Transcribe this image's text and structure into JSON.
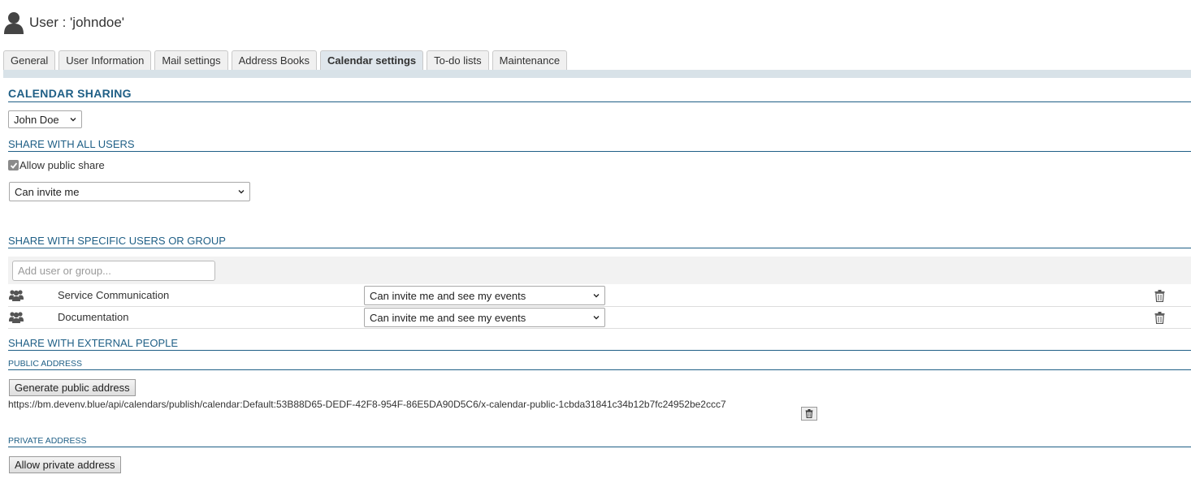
{
  "header": {
    "title": "User : 'johndoe'",
    "icon": "user-icon"
  },
  "tabs": [
    {
      "label": "General",
      "active": false
    },
    {
      "label": "User Information",
      "active": false
    },
    {
      "label": "Mail settings",
      "active": false
    },
    {
      "label": "Address Books",
      "active": false
    },
    {
      "label": "Calendar settings",
      "active": true
    },
    {
      "label": "To-do lists",
      "active": false
    },
    {
      "label": "Maintenance",
      "active": false
    }
  ],
  "calendar_sharing": {
    "heading": "CALENDAR SHARING",
    "calendar_select": "John Doe"
  },
  "share_all": {
    "heading": "SHARE WITH ALL USERS",
    "allow_public_label": "Allow public share",
    "allow_public_checked": true,
    "permission_select": "Can invite me"
  },
  "share_specific": {
    "heading": "SHARE WITH SPECIFIC USERS OR GROUP",
    "add_placeholder": "Add user or group...",
    "rows": [
      {
        "name": "Service Communication",
        "permission": "Can invite me and see my events",
        "icon": "group-icon"
      },
      {
        "name": "Documentation",
        "permission": "Can invite me and see my events",
        "icon": "group-icon"
      }
    ]
  },
  "share_external": {
    "heading": "SHARE WITH EXTERNAL PEOPLE",
    "public_address": {
      "heading": "PUBLIC ADDRESS",
      "button": "Generate public address",
      "url": "https://bm.devenv.blue/api/calendars/publish/calendar:Default:53B88D65-DEDF-42F8-954F-86E5DA90D5C6/x-calendar-public-1cbda31841c34b12b7fc24952be2ccc7"
    },
    "private_address": {
      "heading": "PRIVATE ADDRESS",
      "button": "Allow private address"
    }
  },
  "colors": {
    "heading": "#1f5f86",
    "tabbar": "#d8e2e8"
  }
}
